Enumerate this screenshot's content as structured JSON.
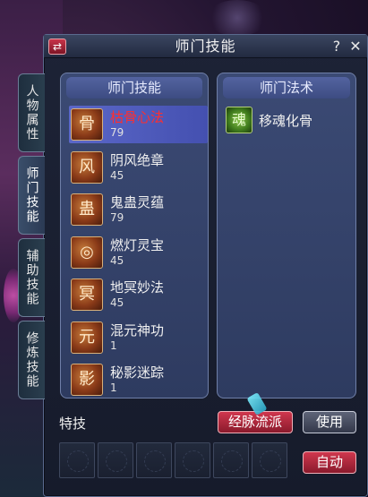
{
  "window": {
    "title": "师门技能",
    "swap_icon": "⇄",
    "help_label": "?",
    "close_label": "✕"
  },
  "side_tabs": [
    {
      "label": "人物属性",
      "active": false
    },
    {
      "label": "师门技能",
      "active": true
    },
    {
      "label": "辅助技能",
      "active": false
    },
    {
      "label": "修炼技能",
      "active": false
    }
  ],
  "skills_panel": {
    "header": "师门技能",
    "items": [
      {
        "name": "枯骨心法",
        "level": "79",
        "icon": "skull-flame-icon",
        "glyph": "骨",
        "selected": true
      },
      {
        "name": "阴风绝章",
        "level": "45",
        "icon": "wind-scroll-icon",
        "glyph": "风",
        "selected": false
      },
      {
        "name": "鬼蛊灵蕴",
        "level": "79",
        "icon": "ghost-insect-icon",
        "glyph": "蛊",
        "selected": false
      },
      {
        "name": "燃灯灵宝",
        "level": "45",
        "icon": "lantern-wheel-icon",
        "glyph": "◎",
        "selected": false
      },
      {
        "name": "地冥妙法",
        "level": "45",
        "icon": "underworld-icon",
        "glyph": "冥",
        "selected": false
      },
      {
        "name": "混元神功",
        "level": "1",
        "icon": "chaos-icon",
        "glyph": "元",
        "selected": false
      },
      {
        "name": "秘影迷踪",
        "level": "1",
        "icon": "shadow-step-icon",
        "glyph": "影",
        "selected": false
      }
    ]
  },
  "spells_panel": {
    "header": "师门法术",
    "items": [
      {
        "name": "移魂化骨",
        "icon": "soul-transform-icon",
        "glyph": "魂"
      }
    ]
  },
  "special": {
    "label": "特技",
    "slots": 6
  },
  "buttons": {
    "meridian": "经脉流派",
    "use": "使用",
    "auto": "自动"
  }
}
